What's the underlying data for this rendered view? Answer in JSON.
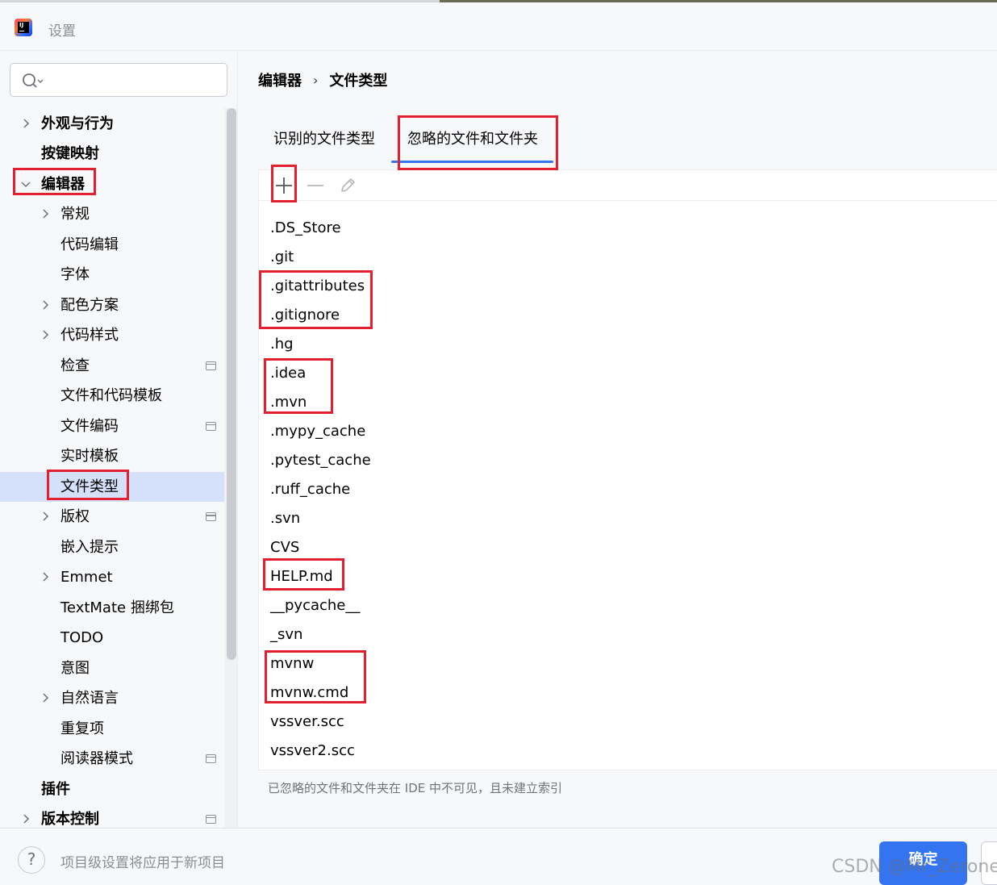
{
  "window": {
    "title": "设置"
  },
  "search": {
    "placeholder": ""
  },
  "sidebar": {
    "items": [
      {
        "label": "外观与行为",
        "bold": true,
        "chevron": "right",
        "level": 0
      },
      {
        "label": "按键映射",
        "bold": true,
        "chevron": "",
        "level": 0
      },
      {
        "label": "编辑器",
        "bold": true,
        "chevron": "down",
        "level": 0
      },
      {
        "label": "常规",
        "bold": false,
        "chevron": "right",
        "level": 1
      },
      {
        "label": "代码编辑",
        "bold": false,
        "chevron": "",
        "level": 1
      },
      {
        "label": "字体",
        "bold": false,
        "chevron": "",
        "level": 1
      },
      {
        "label": "配色方案",
        "bold": false,
        "chevron": "right",
        "level": 1
      },
      {
        "label": "代码样式",
        "bold": false,
        "chevron": "right",
        "level": 1
      },
      {
        "label": "检查",
        "bold": false,
        "chevron": "",
        "level": 1,
        "project_icon": true
      },
      {
        "label": "文件和代码模板",
        "bold": false,
        "chevron": "",
        "level": 1
      },
      {
        "label": "文件编码",
        "bold": false,
        "chevron": "",
        "level": 1,
        "project_icon": true
      },
      {
        "label": "实时模板",
        "bold": false,
        "chevron": "",
        "level": 1
      },
      {
        "label": "文件类型",
        "bold": false,
        "chevron": "",
        "level": 1,
        "selected": true
      },
      {
        "label": "版权",
        "bold": false,
        "chevron": "right",
        "level": 1,
        "project_icon": true
      },
      {
        "label": "嵌入提示",
        "bold": false,
        "chevron": "",
        "level": 1
      },
      {
        "label": "Emmet",
        "bold": false,
        "chevron": "right",
        "level": 1
      },
      {
        "label": "TextMate 捆绑包",
        "bold": false,
        "chevron": "",
        "level": 1
      },
      {
        "label": "TODO",
        "bold": false,
        "chevron": "",
        "level": 1
      },
      {
        "label": "意图",
        "bold": false,
        "chevron": "",
        "level": 1
      },
      {
        "label": "自然语言",
        "bold": false,
        "chevron": "right",
        "level": 1
      },
      {
        "label": "重复项",
        "bold": false,
        "chevron": "",
        "level": 1
      },
      {
        "label": "阅读器模式",
        "bold": false,
        "chevron": "",
        "level": 1,
        "project_icon": true
      },
      {
        "label": "插件",
        "bold": true,
        "chevron": "",
        "level": 0
      },
      {
        "label": "版本控制",
        "bold": true,
        "chevron": "right",
        "level": 0,
        "project_icon": true
      }
    ]
  },
  "breadcrumb": {
    "parent": "编辑器",
    "separator": "›",
    "current": "文件类型"
  },
  "tabs": [
    {
      "label": "识别的文件类型",
      "active": false
    },
    {
      "label": "忽略的文件和文件夹",
      "active": true
    }
  ],
  "toolbar": {
    "add": "add-icon",
    "remove": "remove-icon",
    "edit": "edit-icon"
  },
  "ignored_files": [
    ".DS_Store",
    ".git",
    ".gitattributes",
    ".gitignore",
    ".hg",
    ".idea",
    ".mvn",
    ".mypy_cache",
    ".pytest_cache",
    ".ruff_cache",
    ".svn",
    "CVS",
    "HELP.md",
    "__pycache__",
    "_svn",
    "mvnw",
    "mvnw.cmd",
    "vssver.scc",
    "vssver2.scc"
  ],
  "hint": "已忽略的文件和文件夹在 IDE 中不可见，且未建立索引",
  "footer": {
    "help": "?",
    "note": "项目级设置将应用于新项目",
    "ok": "确定"
  },
  "watermark": "CSDN @Mr_Zerone",
  "colors": {
    "accent": "#3574f0",
    "selection": "#d5e1fb",
    "annotation": "#e3202f"
  }
}
